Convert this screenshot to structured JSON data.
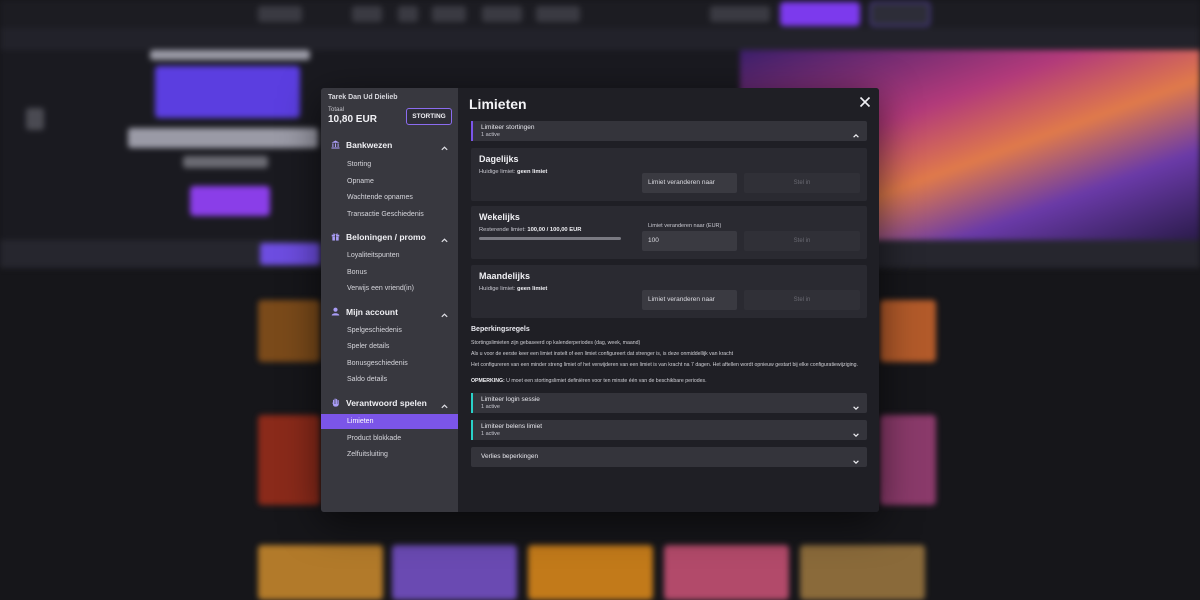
{
  "sidebar": {
    "username": "Tarek Dan Ud Dielieb",
    "total_label": "Totaal",
    "total": "10,80 EUR",
    "deposit_button": "STORTING",
    "sections": [
      {
        "label": "Bankwezen",
        "icon": "bank-icon",
        "items": [
          "Storting",
          "Opname",
          "Wachtende opnames",
          "Transactie Geschiedenis"
        ]
      },
      {
        "label": "Beloningen / promo",
        "icon": "gift-icon",
        "items": [
          "Loyaliteitspunten",
          "Bonus",
          "Verwijs een vriend(in)"
        ]
      },
      {
        "label": "Mijn account",
        "icon": "user-icon",
        "items": [
          "Spelgeschiedenis",
          "Speler details",
          "Bonusgeschiedenis",
          "Saldo details"
        ]
      },
      {
        "label": "Verantwoord spelen",
        "icon": "hand-icon",
        "items": [
          "Limieten",
          "Product blokkade",
          "Zelfuitsluiting"
        ]
      }
    ],
    "active_item": "Limieten"
  },
  "content": {
    "title": "Limieten",
    "deposit_limit": {
      "title": "Limiteer stortingen",
      "subtitle": "1 active"
    },
    "cards": [
      {
        "title": "Dagelijks",
        "info_label": "Huidige limiet: ",
        "info_value": "geen limiet",
        "field_value": "Limiet veranderen naar",
        "button": "Stel in"
      },
      {
        "title": "Wekelijks",
        "info_label": "Resterende limiet: ",
        "info_value": "100,00 / 100,00 EUR",
        "progress": 1.0,
        "field_label": "Limiet veranderen naar (EUR)",
        "field_value": "100",
        "button": "Stel in"
      },
      {
        "title": "Maandelijks",
        "info_label": "Huidige limiet: ",
        "info_value": "geen limiet",
        "field_value": "Limiet veranderen naar",
        "button": "Stel in"
      }
    ],
    "rules": {
      "title": "Beperkingsregels",
      "lines": [
        "Stortingslimieten zijn gebaseerd op kalenderperiodes (dag, week, maand)",
        "Als u voor de eerste keer een limiet instelt of een limiet configureert dat strenger is, is deze onmiddellijk van kracht",
        "Het configureren van een minder streng limiet of het verwijderen van een limiet is van kracht na 7 dagen. Het aftellen wordt opnieuw gestart bij elke configuratiewijziging."
      ],
      "note_label": "OPMERKING:",
      "note_text": " U moet een stortingslimiet definiëren voor ten minste één van de beschikbare periodes."
    },
    "other_limits": [
      {
        "title": "Limiteer login sessie",
        "subtitle": "1 active"
      },
      {
        "title": "Limiteer belens limiet",
        "subtitle": "1 active"
      },
      {
        "title": "Verlies beperkingen"
      }
    ]
  },
  "colors": {
    "accent": "#7b55e8",
    "accent_bar_purple": "#7b55e8",
    "accent_bar_teal": "#2ad1c9"
  }
}
